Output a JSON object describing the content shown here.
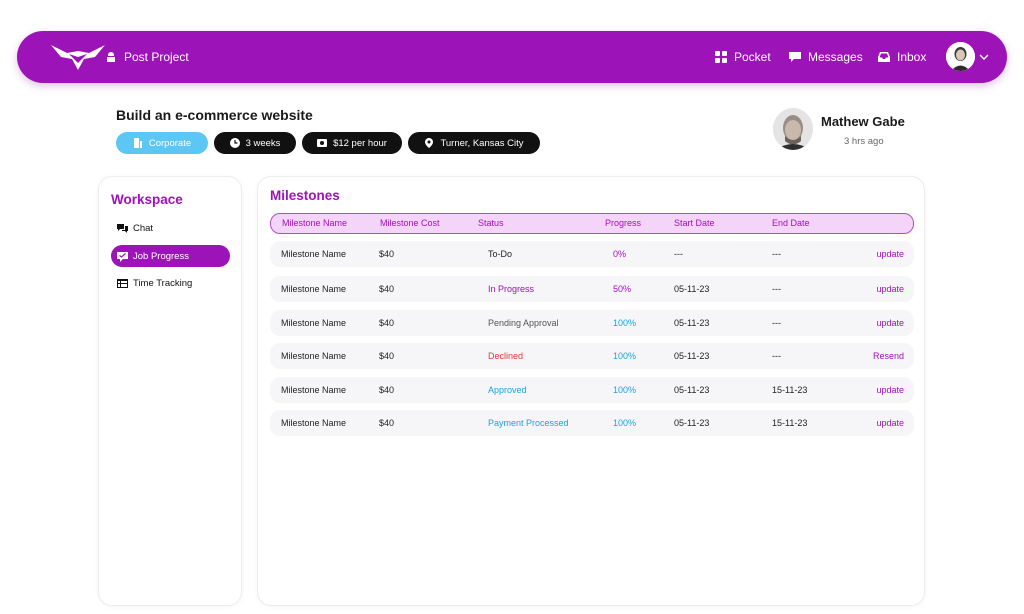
{
  "nav": {
    "post_project": "Post Project",
    "pocket": "Pocket",
    "messages": "Messages",
    "inbox": "Inbox",
    "brand_color": "#9c13b8"
  },
  "project": {
    "title": "Build an e-commerce website",
    "tags": {
      "category": "Corporate",
      "duration": "3 weeks",
      "rate": "$12 per hour",
      "location": "Turner, Kansas City"
    }
  },
  "client": {
    "name": "Mathew Gabe",
    "time": "3 hrs ago"
  },
  "sidebar": {
    "title": "Workspace",
    "items": [
      {
        "label": "Chat",
        "icon": "chat-icon"
      },
      {
        "label": "Job Progress",
        "icon": "progress-icon",
        "active": true
      },
      {
        "label": "Time Tracking",
        "icon": "table-icon"
      }
    ]
  },
  "milestones": {
    "title": "Milestones",
    "columns": [
      "Milestone Name",
      "Milestone Cost",
      "Status",
      "Progress",
      "Start Date",
      "End Date"
    ],
    "rows": [
      {
        "name": "Milestone Name",
        "cost": "$40",
        "status": "To-Do",
        "status_color": "#222222",
        "progress": "0%",
        "progress_color": "#9c13b8",
        "start": "---",
        "end": "---",
        "action": "update"
      },
      {
        "name": "Milestone Name",
        "cost": "$40",
        "status": "In Progress",
        "status_color": "#9c13b8",
        "progress": "50%",
        "progress_color": "#9c13b8",
        "start": "05-11-23",
        "end": "---",
        "action": "update"
      },
      {
        "name": "Milestone Name",
        "cost": "$40",
        "status": "Pending Approval",
        "status_color": "#555555",
        "progress": "100%",
        "progress_color": "#1aa3d9",
        "start": "05-11-23",
        "end": "---",
        "action": "update"
      },
      {
        "name": "Milestone Name",
        "cost": "$40",
        "status": "Declined",
        "status_color": "#e53935",
        "progress": "100%",
        "progress_color": "#1aa3d9",
        "start": "05-11-23",
        "end": "---",
        "action": "Resend"
      },
      {
        "name": "Milestone Name",
        "cost": "$40",
        "status": "Approved",
        "status_color": "#1aa3d9",
        "progress": "100%",
        "progress_color": "#1aa3d9",
        "start": "05-11-23",
        "end": "15-11-23",
        "action": "update"
      },
      {
        "name": "Milestone Name",
        "cost": "$40",
        "status": "Payment Processed",
        "status_color": "#1aa3d9",
        "progress": "100%",
        "progress_color": "#1aa3d9",
        "start": "05-11-23",
        "end": "15-11-23",
        "action": "update"
      }
    ]
  }
}
